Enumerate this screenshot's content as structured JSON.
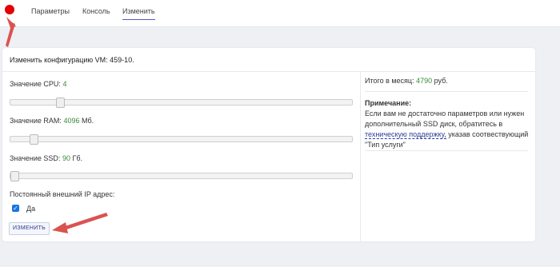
{
  "nav": {
    "tabs": [
      {
        "label": "Параметры"
      },
      {
        "label": "Консоль"
      },
      {
        "label": "Изменить"
      }
    ]
  },
  "form": {
    "title": "Изменить конфигурацию VM: 459-10.",
    "cpu": {
      "label": "Значение CPU:",
      "value": "4",
      "unit": "",
      "slider_level": 0.145
    },
    "ram": {
      "label": "Значение RAM:",
      "value": "4096",
      "unit": "Мб.",
      "slider_level": 0.067
    },
    "ssd": {
      "label": "Значение SSD:",
      "value": "90",
      "unit": "Гб.",
      "slider_level": 0.0
    },
    "ip": {
      "label": "Постоянный внешний IP адрес:",
      "checkbox_label": "Да",
      "checked": true
    },
    "submit_label": "ИЗМЕНИТЬ"
  },
  "summary": {
    "total_label": "Итого в месяц:",
    "total_value": "4790",
    "total_unit": "руб."
  },
  "note": {
    "title": "Примечание:",
    "text_before": "Если вам не достаточно параметров или нужен дополнительный SSD диск, обратитесь в",
    "link": "техническую поддержку,",
    "text_after": "указав соотвествующий \"Тип услуги\""
  },
  "colors": {
    "accent": "#5a57c8",
    "value_green": "#3a8a3a",
    "status_red": "#e30000",
    "annotation_arrow": "#d9534f"
  }
}
